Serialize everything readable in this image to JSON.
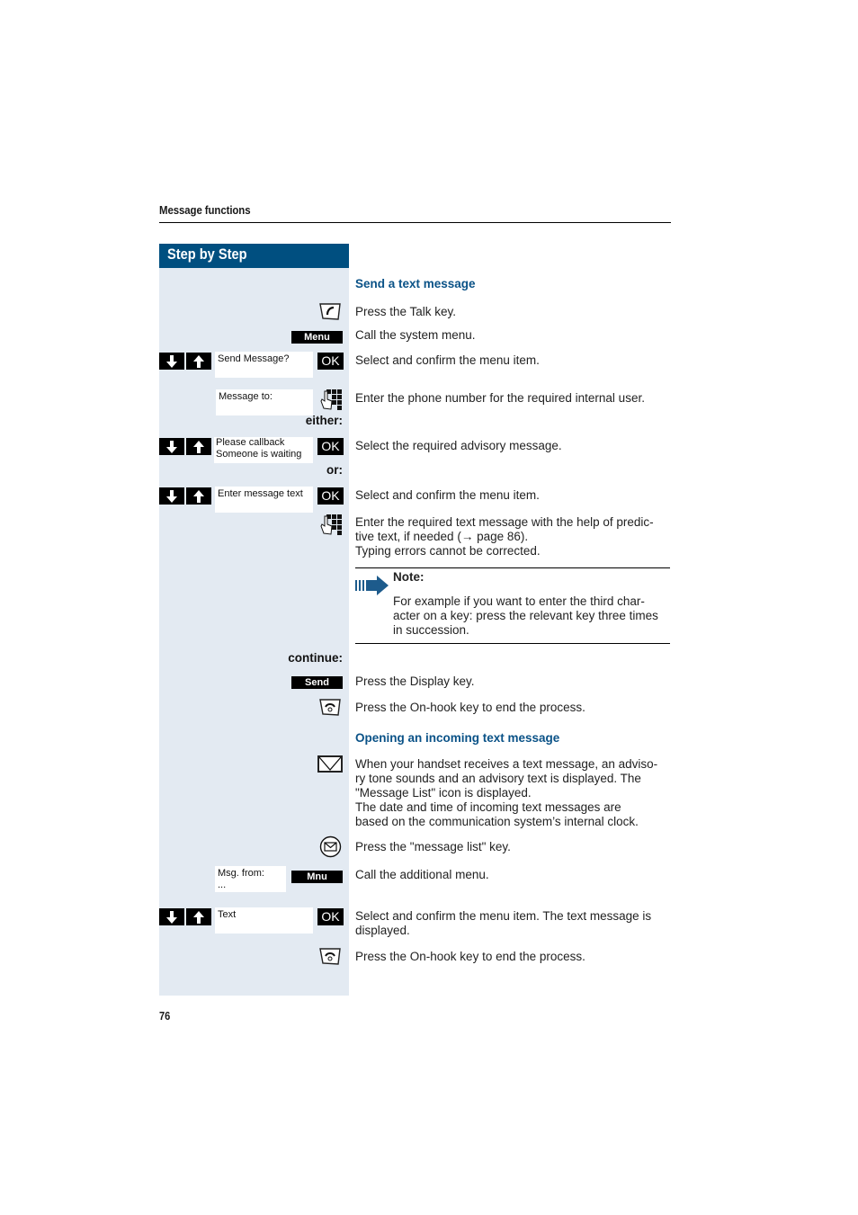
{
  "header": {
    "title": "Message functions"
  },
  "sidebar": {
    "title": "Step by Step"
  },
  "sections": [
    {
      "title": "Send a text message"
    },
    {
      "title": "Opening an incoming text message"
    }
  ],
  "steps": {
    "talk_key": {
      "icon": "talk-key-icon",
      "text": "Press the Talk key."
    },
    "menu": {
      "softkey": "Menu",
      "text": "Call the system menu."
    },
    "send_message": {
      "display": "Send Message?",
      "ok": "OK",
      "text": "Select and confirm the menu item."
    },
    "message_to": {
      "display": "Message to:",
      "icon": "keypad-icon",
      "text": "Enter the phone number for the required internal user."
    },
    "either": {
      "label": "either:"
    },
    "advisory": {
      "display_line1": "Please callback",
      "display_line2": "Someone is waiting",
      "ok": "OK",
      "text": "Select the required advisory message."
    },
    "or": {
      "label": "or:"
    },
    "enter_text": {
      "display": "Enter message text",
      "ok": "OK",
      "text": "Select and confirm the menu item."
    },
    "type_text": {
      "icon": "keypad-icon",
      "line1": "Enter the required text message with the help of predic-",
      "line2": "tive text, if needed (→ page 86).",
      "line3": "Typing errors cannot be corrected."
    },
    "note": {
      "title": "Note:",
      "line1": "For example  if you want to enter the third char-",
      "line2": "acter on a key: press the relevant key three times",
      "line3": "in succession."
    },
    "continue": {
      "label": "continue:"
    },
    "send": {
      "softkey": "Send",
      "text": "Press the Display key."
    },
    "onhook1": {
      "icon": "on-hook-key-icon",
      "text": "Press the On-hook key to end the process."
    },
    "incoming": {
      "icon": "message-list-icon",
      "line1": "When your handset receives a text message, an adviso-",
      "line2": "ry tone sounds and an advisory text is displayed. The",
      "line3": "\"Message List\" icon is displayed.",
      "line4": "The date and time of incoming text messages are",
      "line5": "based on the communication system’s internal clock."
    },
    "msg_list_key": {
      "icon": "message-key-icon",
      "text": "Press the \"message list\" key."
    },
    "msg_from": {
      "display_line1": "Msg. from:",
      "display_line2": "...",
      "softkey": "Mnu",
      "text": "Call the additional menu."
    },
    "text_item": {
      "display": "Text",
      "ok": "OK",
      "line1": "Select and confirm the menu item. The text message is",
      "line2": "displayed."
    },
    "onhook2": {
      "icon": "on-hook-key-icon",
      "text": "Press the On-hook key to end the process."
    }
  },
  "footer": {
    "page_number": "76"
  },
  "colors": {
    "brand_blue": "#004f80",
    "section_blue": "#0a5287",
    "sidebar_bg": "#e3eaf2"
  }
}
